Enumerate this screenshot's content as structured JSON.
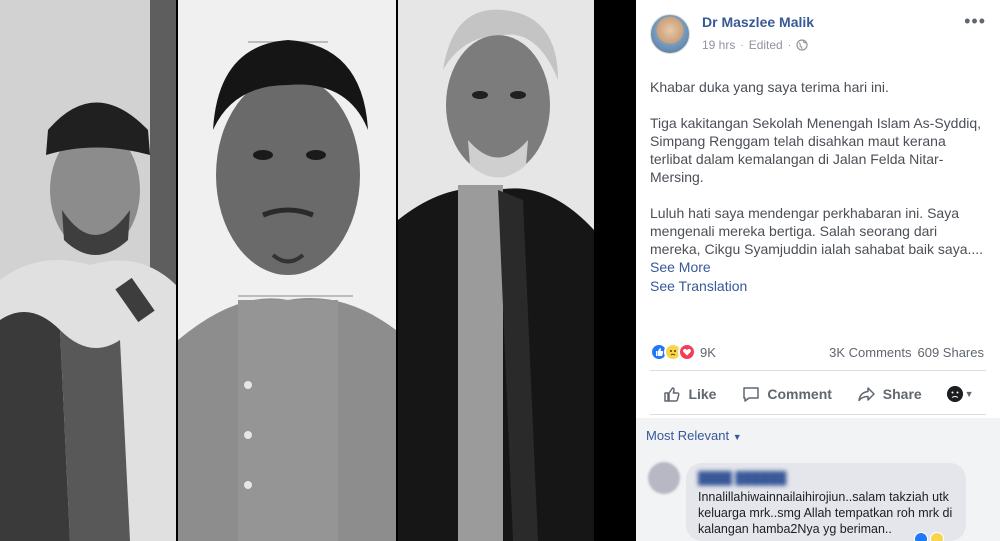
{
  "post": {
    "author": "Dr Maszlee Malik",
    "time": "19 hrs",
    "edited": "Edited",
    "paragraph1": "Khabar duka yang saya terima hari ini.",
    "paragraph2": "Tiga kakitangan Sekolah Menengah Islam As-Syddiq, Simpang Renggam telah disahkan maut kerana terlibat dalam kemalangan di Jalan Felda Nitar-Mersing.",
    "paragraph3": "Luluh hati saya mendengar perkhabaran ini. Saya mengenali mereka bertiga. Salah seorang dari mereka, Cikgu Syamjuddin ialah sahabat baik saya....",
    "see_more": "See More",
    "see_translation": "See Translation"
  },
  "stats": {
    "reaction_count": "9K",
    "comments": "3K Comments",
    "shares": "609 Shares"
  },
  "actions": {
    "like": "Like",
    "comment": "Comment",
    "share": "Share"
  },
  "comments": {
    "sort_label": "Most Relevant",
    "first": {
      "text": "Innalillahiwainnailaihirojiun..salam takziah utk keluarga mrk..smg Allah tempatkan roh mrk di kalangan hamba2Nya yg beriman.."
    }
  },
  "icons": {
    "like": "like-icon",
    "comment": "comment-icon",
    "share": "share-icon",
    "globe": "globe-icon",
    "more": "more-horizontal-icon"
  },
  "colors": {
    "link": "#385898",
    "like_blue": "#2078f4",
    "love_red": "#f33e58",
    "sad_yellow": "#f7d54a"
  }
}
